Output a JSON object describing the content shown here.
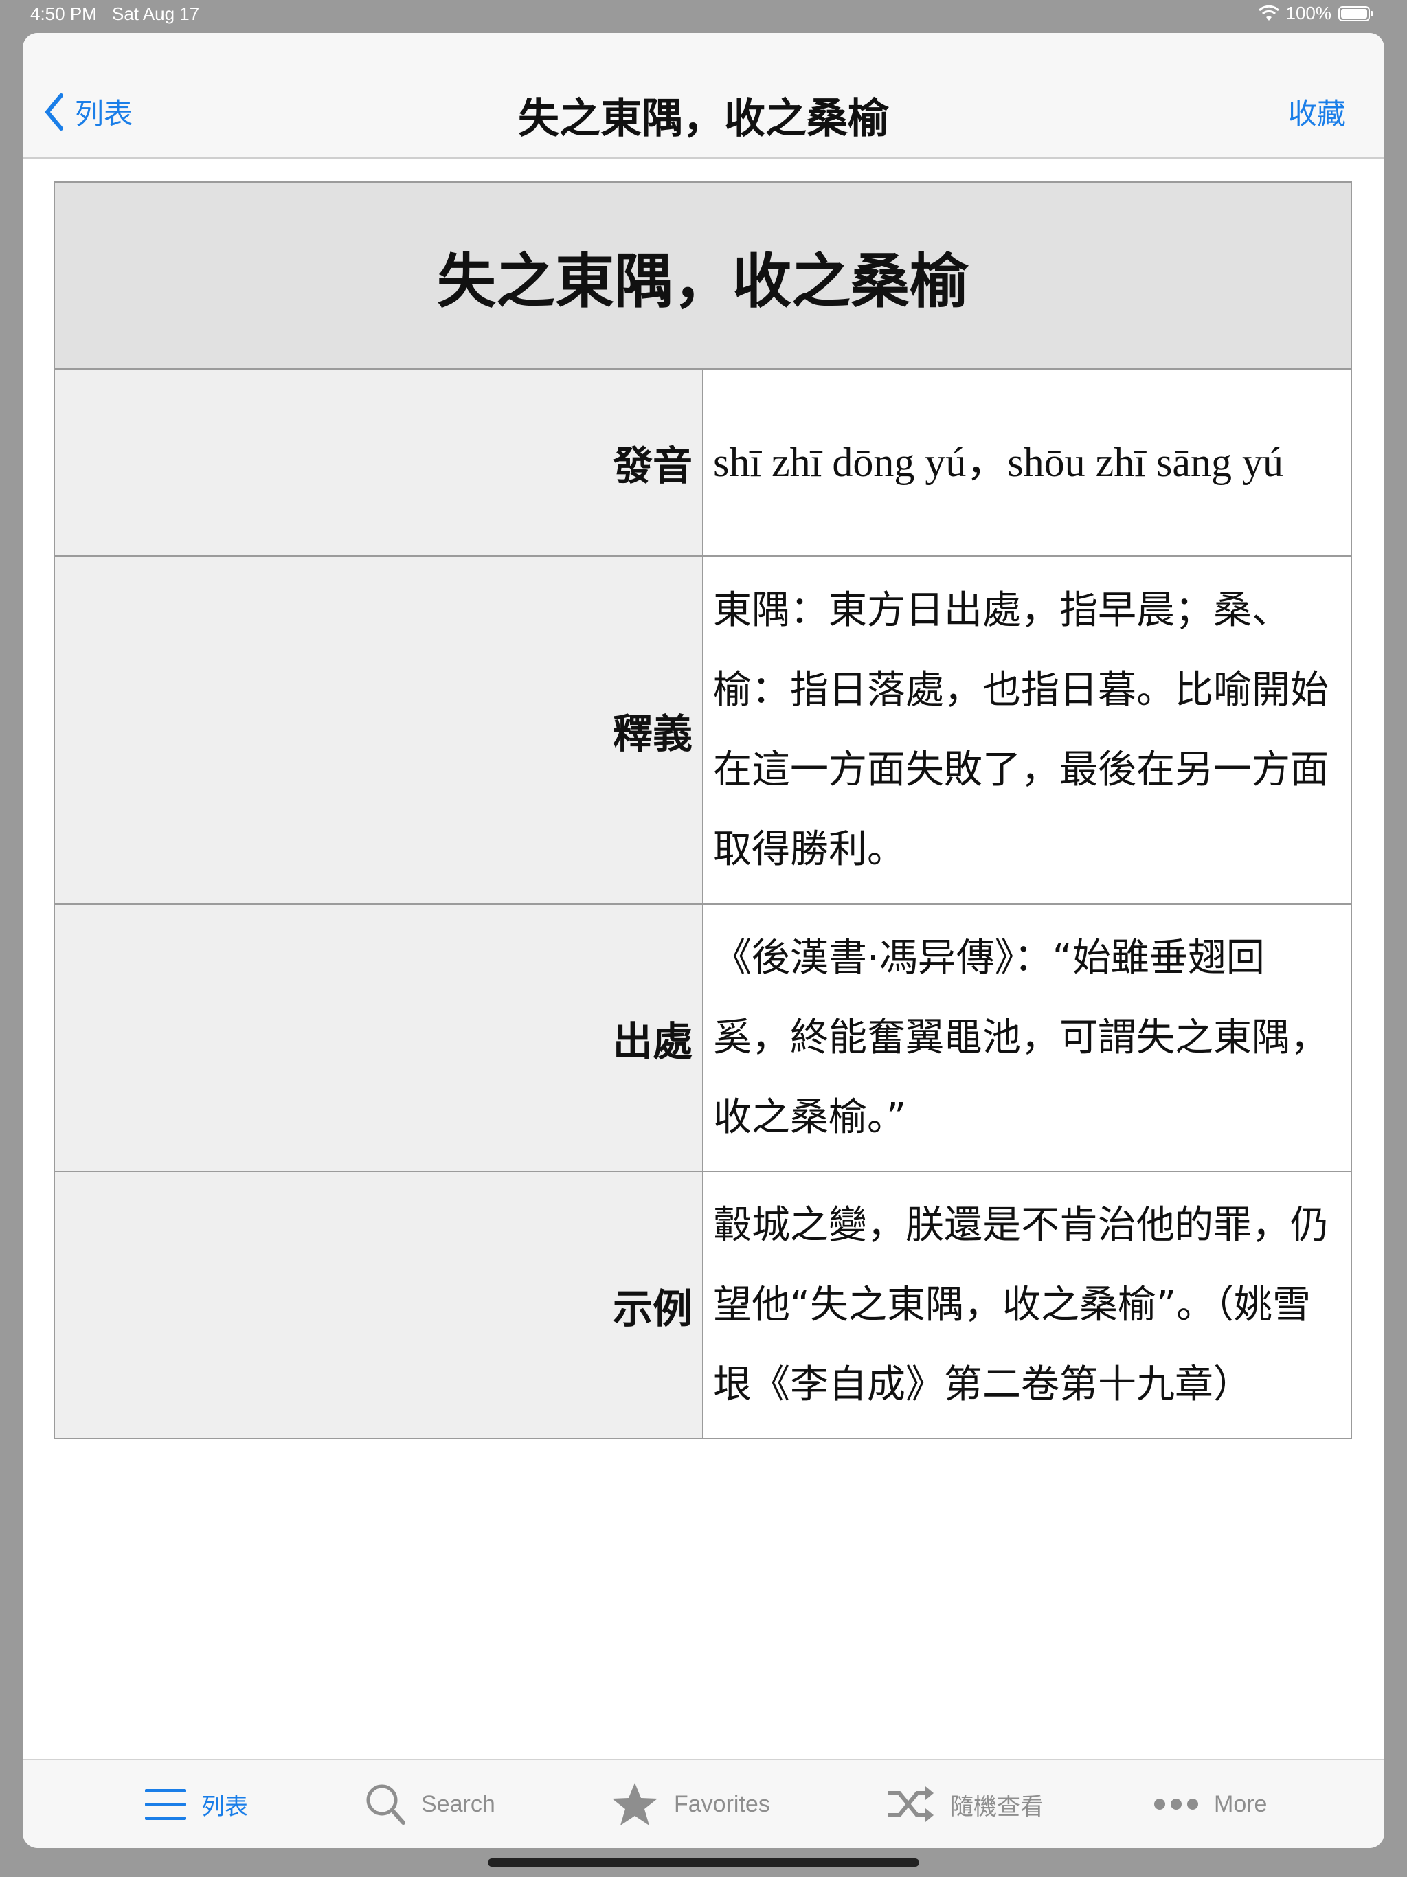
{
  "status_bar": {
    "time": "4:50 PM",
    "date": "Sat Aug 17",
    "battery": "100%"
  },
  "nav": {
    "back_label": "列表",
    "title": "失之東隅，收之桑榆",
    "favorite_label": "收藏"
  },
  "entry": {
    "idiom": "失之東隅，收之桑榆",
    "rows": [
      {
        "label": "發音",
        "value": "shī zhī dōng yú，shōu zhī sāng yú"
      },
      {
        "label": "釋義",
        "value": "東隅：東方日出處，指早晨；桑、榆：指日落處，也指日暮。比喻開始在這一方面失敗了，最後在另一方面取得勝利。"
      },
      {
        "label": "出處",
        "value": "《後漢書·馮异傳》：“始雖垂翅回奚，終能奮翼黽池，可謂失之東隅，收之桑榆。”"
      },
      {
        "label": "示例",
        "value": "轂城之變，朕還是不肯治他的罪，仍望他“失之東隅，收之桑榆”。（姚雪垠《李自成》第二卷第十九章）"
      }
    ]
  },
  "tab_bar": {
    "items": [
      {
        "label": "列表",
        "icon": "list-icon",
        "active": true
      },
      {
        "label": "Search",
        "icon": "search-icon",
        "active": false
      },
      {
        "label": "Favorites",
        "icon": "star-icon",
        "active": false
      },
      {
        "label": "隨機查看",
        "icon": "shuffle-icon",
        "active": false
      },
      {
        "label": "More",
        "icon": "more-icon",
        "active": false
      }
    ]
  },
  "colors": {
    "accent": "#1a7ee8",
    "inactive": "#8e8e8e",
    "header_bg": "#e1e1e1",
    "label_bg": "#efefef"
  }
}
